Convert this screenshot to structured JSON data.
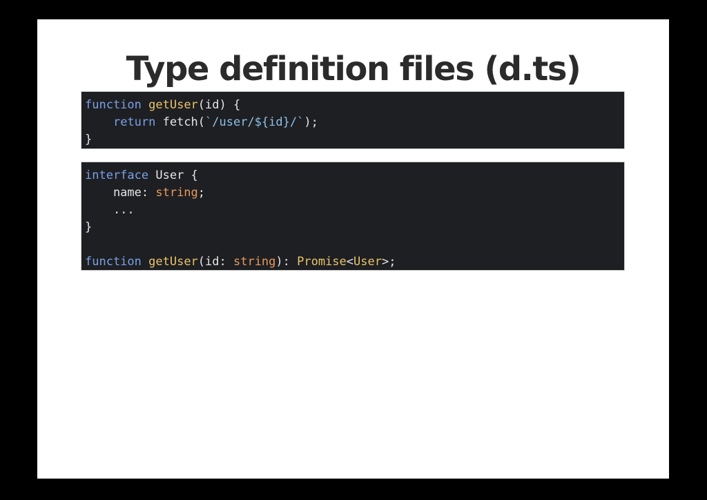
{
  "title": "Type definition files (d.ts)",
  "code_block_1": {
    "lines": [
      [
        {
          "text": "function",
          "kind": "kw"
        },
        {
          "text": " ",
          "kind": "plain"
        },
        {
          "text": "getUser",
          "kind": "fn"
        },
        {
          "text": "(id) {",
          "kind": "plain"
        }
      ],
      [
        {
          "text": "    ",
          "kind": "plain"
        },
        {
          "text": "return",
          "kind": "kw"
        },
        {
          "text": " fetch(",
          "kind": "plain"
        },
        {
          "text": "`/user/${id}/`",
          "kind": "str"
        },
        {
          "text": ");",
          "kind": "plain"
        }
      ],
      [
        {
          "text": "}",
          "kind": "plain"
        }
      ]
    ]
  },
  "code_block_2": {
    "lines": [
      [
        {
          "text": "interface",
          "kind": "kw"
        },
        {
          "text": " User {",
          "kind": "plain"
        }
      ],
      [
        {
          "text": "    name: ",
          "kind": "plain"
        },
        {
          "text": "string",
          "kind": "type"
        },
        {
          "text": ";",
          "kind": "plain"
        }
      ],
      [
        {
          "text": "    ...",
          "kind": "plain"
        }
      ],
      [
        {
          "text": "}",
          "kind": "plain"
        }
      ],
      [
        {
          "text": "",
          "kind": "plain"
        }
      ],
      [
        {
          "text": "function",
          "kind": "kw"
        },
        {
          "text": " ",
          "kind": "plain"
        },
        {
          "text": "getUser",
          "kind": "fn"
        },
        {
          "text": "(id: ",
          "kind": "plain"
        },
        {
          "text": "string",
          "kind": "type"
        },
        {
          "text": "): ",
          "kind": "plain"
        },
        {
          "text": "Promise",
          "kind": "fn"
        },
        {
          "text": "<",
          "kind": "plain"
        },
        {
          "text": "User",
          "kind": "fn"
        },
        {
          "text": ">;",
          "kind": "plain"
        }
      ]
    ]
  },
  "colors": {
    "keyword": "#7aa0e8",
    "function": "#e9c46a",
    "string": "#8ec0e8",
    "type": "#e89a5c",
    "code_background": "#1e1f22",
    "slide_background": "#ffffff",
    "frame_background": "#000000"
  }
}
